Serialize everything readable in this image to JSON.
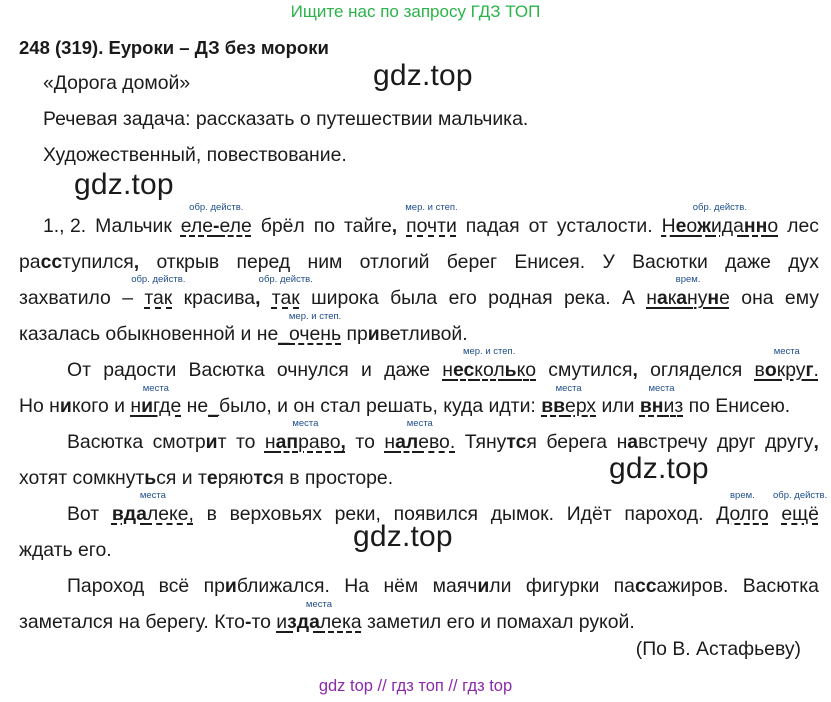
{
  "banner": "Ищите нас по запросу ГДЗ ТОП",
  "heading": "248 (319). Еуроки – ДЗ без мороки",
  "title_line": "«Дорога домой»",
  "task_line": "Речевая задача: рассказать о путешествии мальчика.",
  "style_line": "Художественный, повествование.",
  "watermark": "gdz.top",
  "notes": {
    "obr": "обр. действ.",
    "mer": "мер. и степ.",
    "vrem": "врем.",
    "mesta": "места"
  },
  "source": "(По В. Астафьеву)",
  "footer": "gdz top  //  гдз топ  //  гдз top"
}
